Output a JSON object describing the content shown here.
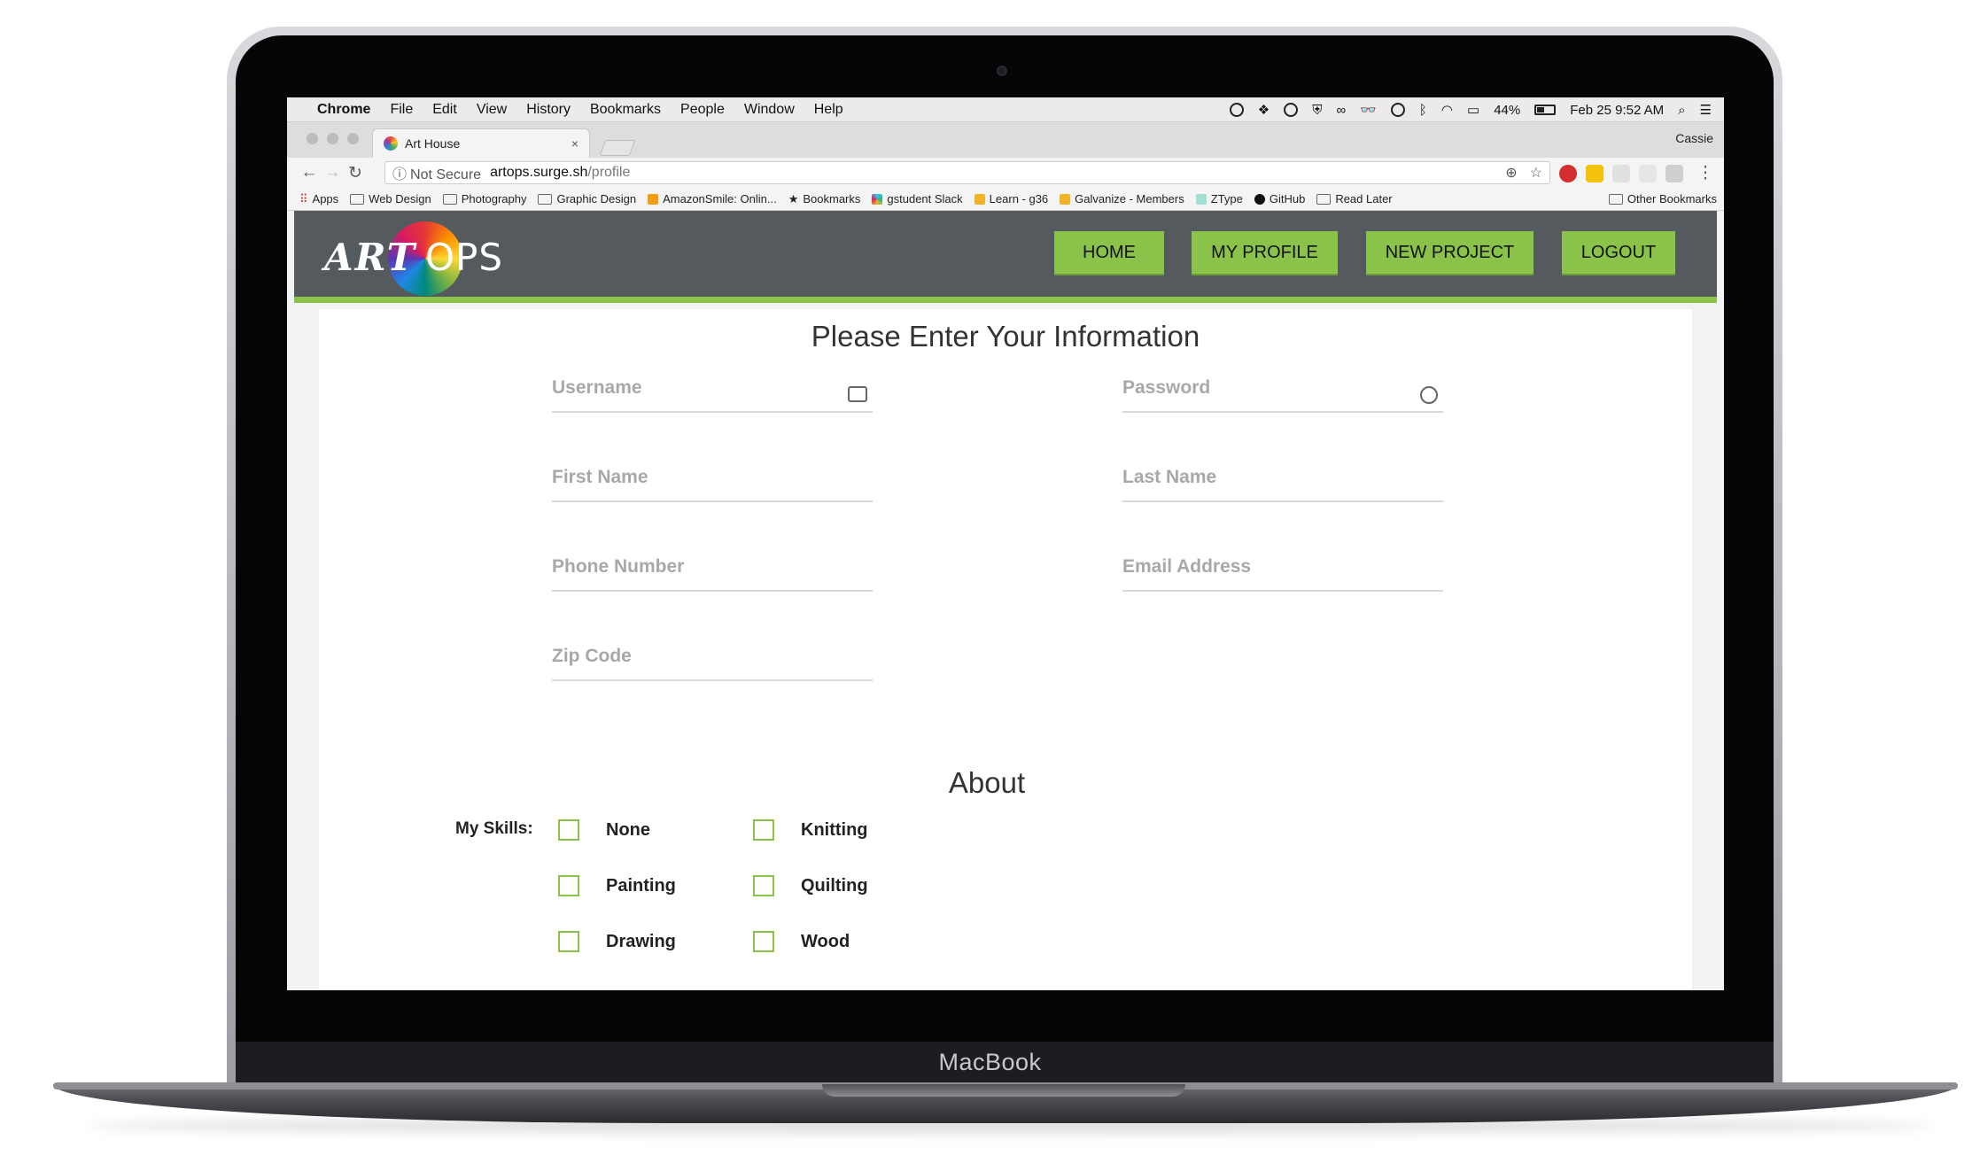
{
  "device": {
    "label": "MacBook"
  },
  "menubar": {
    "apple_icon": "apple-icon",
    "items": [
      "Chrome",
      "File",
      "Edit",
      "View",
      "History",
      "Bookmarks",
      "People",
      "Window",
      "Help"
    ],
    "battery": "44%",
    "datetime": "Feb 25  9:52 AM"
  },
  "browser": {
    "tab_title": "Art House",
    "tab_close": "×",
    "profile": "Cassie",
    "security": "Not Secure",
    "url_host": "artops.surge.sh",
    "url_path": "/profile",
    "bookmarks": [
      {
        "label": "Apps",
        "kind": "apps"
      },
      {
        "label": "Web Design",
        "kind": "folder"
      },
      {
        "label": "Photography",
        "kind": "folder"
      },
      {
        "label": "Graphic Design",
        "kind": "folder"
      },
      {
        "label": "AmazonSmile: Onlin...",
        "kind": "site"
      },
      {
        "label": "Bookmarks",
        "kind": "star"
      },
      {
        "label": "gstudent Slack",
        "kind": "site"
      },
      {
        "label": "Learn - g36",
        "kind": "site"
      },
      {
        "label": "Galvanize - Members",
        "kind": "site"
      },
      {
        "label": "ZType",
        "kind": "site"
      },
      {
        "label": "GitHub",
        "kind": "site"
      },
      {
        "label": "Read Later",
        "kind": "folder"
      }
    ],
    "other_bookmarks": "Other Bookmarks"
  },
  "site": {
    "logo_text": "ART",
    "logo_text2": "OPS",
    "nav": [
      "HOME",
      "MY PROFILE",
      "NEW PROJECT",
      "LOGOUT"
    ],
    "accent": "#8bc34a",
    "header_bg": "#555a5f"
  },
  "form": {
    "title": "Please Enter Your Information",
    "placeholders": {
      "username": "Username",
      "password": "Password",
      "first_name": "First Name",
      "last_name": "Last Name",
      "phone": "Phone Number",
      "email": "Email Address",
      "zip": "Zip Code"
    }
  },
  "about": {
    "title": "About",
    "skills_label": "My Skills:",
    "skills": [
      "None",
      "Knitting",
      "Painting",
      "Quilting",
      "Drawing",
      "Wood"
    ]
  }
}
